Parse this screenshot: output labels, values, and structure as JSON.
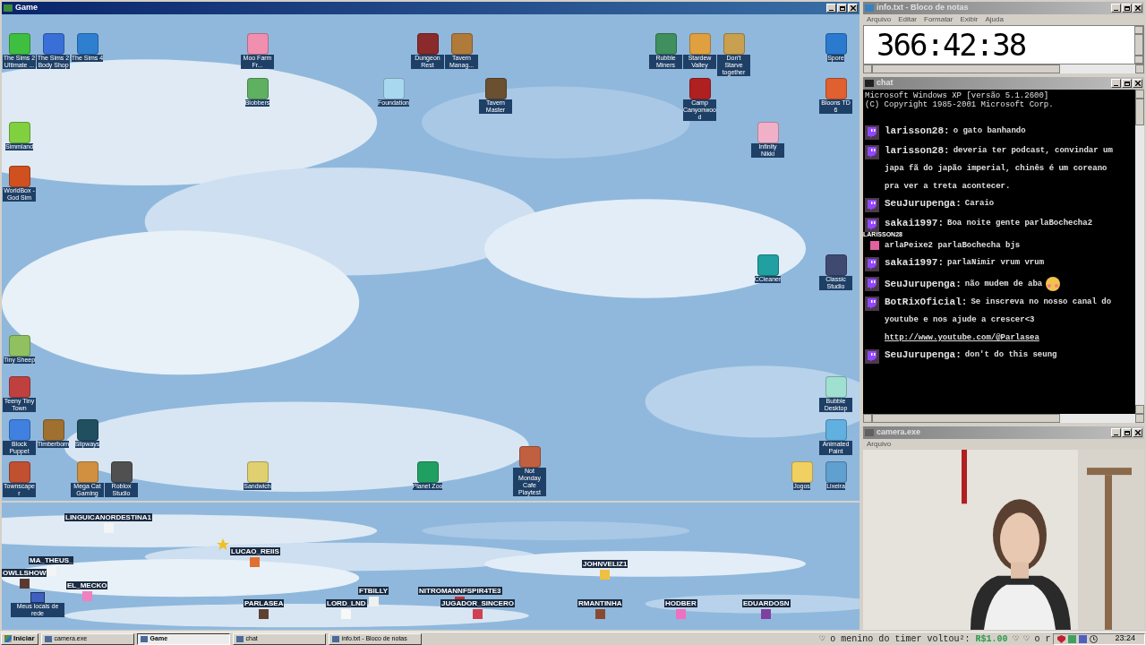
{
  "game_window": {
    "title": "Game",
    "desktop_icons": [
      {
        "label": "The Sims 2 Ultimate ...",
        "color": "#3fbf3f"
      },
      {
        "label": "The Sims 2 Body Shop",
        "color": "#3a6fd8"
      },
      {
        "label": "The Sims 4",
        "color": "#2f7fd0"
      },
      {
        "label": "Moo Farm Fr...",
        "color": "#f08fb0"
      },
      {
        "label": "Dungeon Rest",
        "color": "#8a2a2a"
      },
      {
        "label": "Tavern Manag...",
        "color": "#b07a3a"
      },
      {
        "label": "Rubble Miners",
        "color": "#3f8f5f"
      },
      {
        "label": "Stardew Valley",
        "color": "#e0a040"
      },
      {
        "label": "Don't Starve together",
        "color": "#c8a050"
      },
      {
        "label": "Spore",
        "color": "#2a7ad0"
      },
      {
        "label": "Blobbers",
        "color": "#5fb060"
      },
      {
        "label": "Foundation",
        "color": "#a8d8f0"
      },
      {
        "label": "Tavern Master",
        "color": "#6a5030"
      },
      {
        "label": "Camp Canyonwood",
        "color": "#b02020"
      },
      {
        "label": "Bloons TD 6",
        "color": "#e06030"
      },
      {
        "label": "Simmland",
        "color": "#80d040"
      },
      {
        "label": "WorldBox - God Sim",
        "color": "#d05020"
      },
      {
        "label": "Infinity Nikki",
        "color": "#f0b0c8"
      },
      {
        "label": "CCleaner",
        "color": "#20a0a0"
      },
      {
        "label": "Classic Studio",
        "color": "#404a70"
      },
      {
        "label": "Tiny Sheep",
        "color": "#90c060"
      },
      {
        "label": "Teeny Tiny Town",
        "color": "#c04040"
      },
      {
        "label": "Bubble Desktop",
        "color": "#a0e0d0"
      },
      {
        "label": "Block Puppet",
        "color": "#4080e0"
      },
      {
        "label": "Timberborn",
        "color": "#a07030"
      },
      {
        "label": "Slipways",
        "color": "#205060"
      },
      {
        "label": "Animated Paint",
        "color": "#60b0e0"
      },
      {
        "label": "Townscaper",
        "color": "#c05030"
      },
      {
        "label": "Mega Cat Gaming",
        "color": "#d09040"
      },
      {
        "label": "Roblox Studio",
        "color": "#505050"
      },
      {
        "label": "Sandwich",
        "color": "#e0d070"
      },
      {
        "label": "Planet Zoo",
        "color": "#20a060"
      },
      {
        "label": "Not Monday Cafe Playtest",
        "color": "#c06040"
      },
      {
        "label": "Jogos",
        "color": "#f0d060"
      },
      {
        "label": "Lixeira",
        "color": "#60a0d0"
      }
    ],
    "network_label": "Meus locais de rede",
    "players": [
      {
        "name": "LINGUICANORDESTINA1",
        "color": "#f4f4f4"
      },
      {
        "name": "LUCAO_REIIS",
        "color": "#e07030"
      },
      {
        "name": "MA_THEUS_",
        "color": "#f4f4f4"
      },
      {
        "name": "OWLLSHOW",
        "color": "#5a3a30"
      },
      {
        "name": "EL_MECKO",
        "color": "#f080c0"
      },
      {
        "name": "FTBILLY",
        "color": "#f0f0f0"
      },
      {
        "name": "NITROMANNFSPIR4TE3",
        "color": "#c03030"
      },
      {
        "name": "JUGADOR_SINCERO",
        "color": "#d04050"
      },
      {
        "name": "JOHNVELIZ1",
        "color": "#f0c040"
      },
      {
        "name": "PARLASEA",
        "color": "#604030"
      },
      {
        "name": "LORD_LND",
        "color": "#f8f8f8"
      },
      {
        "name": "RMANTINHA",
        "color": "#8a4a30"
      },
      {
        "name": "HODBER",
        "color": "#f070c0"
      },
      {
        "name": "EDUARDOSN",
        "color": "#8040a0"
      }
    ]
  },
  "notepad": {
    "title": "info.txt - Bloco de notas",
    "menu": [
      "Arquivo",
      "Editar",
      "Formatar",
      "Exibir",
      "Ajuda"
    ],
    "content": "366:42:38"
  },
  "chat": {
    "title": "chat",
    "header": [
      "Microsoft Windows XP [versão 5.1.2600]",
      "(C) Copyright 1985-2001 Microsoft Corp."
    ],
    "messages": [
      {
        "user": "larisson28:",
        "lines": [
          "o gato banhando"
        ]
      },
      {
        "user": "larisson28:",
        "lines": [
          "deveria ter podcast, convindar um",
          "japa fã do japão imperial, chinês é um coreano",
          "pra ver a treta acontecer."
        ]
      },
      {
        "user": "SeuJurupenga:",
        "lines": [
          "Caraio"
        ]
      },
      {
        "user": "sakai1997:",
        "lines": [
          "Boa noite gente parlaBochecha2",
          "arlaPeixe2 parlaBochecha bjs"
        ],
        "overlay_player": {
          "name": "LARISSON28",
          "color": "#e060a0"
        }
      },
      {
        "user": "sakai1997:",
        "lines": [
          "parlaNimir vrum vrum"
        ]
      },
      {
        "user": "SeuJurupenga:",
        "lines": [
          "não mudem de aba"
        ],
        "emoji": true
      },
      {
        "user": "BotRixOficial:",
        "lines": [
          "Se inscreva no nosso canal do",
          "youtube e nos ajude a crescer<3"
        ],
        "link": "http://www.youtube.com/@Parlasea"
      },
      {
        "user": "SeuJurupenga:",
        "lines": [
          "don't do this seung"
        ]
      }
    ]
  },
  "camera": {
    "title": "camera.exe",
    "menu": [
      "Arquivo"
    ]
  },
  "taskbar": {
    "start": "Iniciar",
    "tasks": [
      {
        "label": "camera.exe",
        "selected": false
      },
      {
        "label": "Game",
        "selected": true
      },
      {
        "label": "chat",
        "selected": false
      },
      {
        "label": "info.txt - Bloco de notas",
        "selected": false
      }
    ],
    "ticker": [
      {
        "text": "♡ o menino do timer voltou²:",
        "kind": "message"
      },
      {
        "text": "R$1.00",
        "kind": "amount"
      },
      {
        "text": "♡",
        "kind": "message"
      },
      {
        "text": "♡ o r",
        "kind": "message"
      }
    ],
    "clock": "23:24"
  }
}
